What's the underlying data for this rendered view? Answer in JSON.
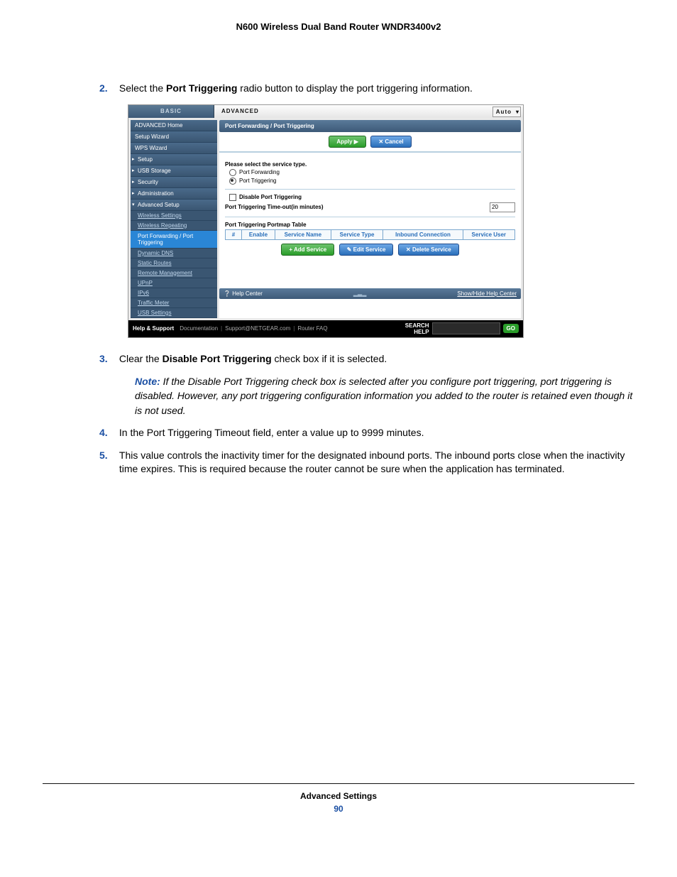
{
  "doc_title": "N600 Wireless Dual Band Router WNDR3400v2",
  "steps": {
    "s2": {
      "num": "2.",
      "pre": "Select the ",
      "bold": "Port Triggering",
      "post": " radio button to display the port triggering information."
    },
    "s3": {
      "num": "3.",
      "pre": "Clear the ",
      "bold": "Disable Port Triggering",
      "post": " check box if it is selected."
    },
    "s4": {
      "num": "4.",
      "text": "In the Port Triggering Timeout field, enter a value up to 9999 minutes."
    },
    "s5": {
      "num": "5.",
      "text": "This value controls the inactivity timer for the designated inbound ports. The inbound ports close when the inactivity time expires. This is required because the router cannot be sure when the application has terminated."
    }
  },
  "note": {
    "label": "Note:",
    "text": " If the Disable Port Triggering check box is selected after you configure port triggering, port triggering is disabled. However, any port triggering configuration information you added to the router is retained even though it is not used."
  },
  "shot": {
    "tabs": {
      "basic": "BASIC",
      "advanced": "ADVANCED",
      "auto": "Auto"
    },
    "sidebar": {
      "home": "ADVANCED Home",
      "setup_wiz": "Setup Wizard",
      "wps_wiz": "WPS Wizard",
      "setup": "Setup",
      "usb": "USB Storage",
      "security": "Security",
      "admin": "Administration",
      "adv_setup": "Advanced Setup",
      "subs": {
        "wireless": "Wireless Settings",
        "repeating": "Wireless Repeating",
        "port": "Port Forwarding / Port Triggering",
        "ddns": "Dynamic DNS",
        "routes": "Static Routes",
        "remote": "Remote Management",
        "upnp": "UPnP",
        "ipv6": "IPv6",
        "traffic": "Traffic Meter",
        "usbset": "USB Settings"
      }
    },
    "content": {
      "title": "Port Forwarding / Port Triggering",
      "apply": "Apply ▶",
      "cancel": "Cancel",
      "select_label": "Please select the service type.",
      "radio_fwd": "Port Forwarding",
      "radio_trig": "Port Triggering",
      "disable_trig": "Disable Port Triggering",
      "timeout_label": "Port Triggering Time-out(in minutes)",
      "timeout_value": "20",
      "portmap_title": "Port Triggering Portmap Table",
      "th": {
        "num": "#",
        "enable": "Enable",
        "name": "Service Name",
        "type": "Service Type",
        "inbound": "Inbound Connection",
        "user": "Service User"
      },
      "add": "Add Service",
      "edit": "Edit Service",
      "delete": "Delete Service",
      "help_center": "Help Center",
      "show_hide": "Show/Hide Help Center"
    },
    "support": {
      "label": "Help & Support",
      "doc": "Documentation",
      "email": "Support@NETGEAR.com",
      "faq": "Router FAQ",
      "search": "SEARCH",
      "help": "HELP",
      "go": "GO"
    }
  },
  "footer": {
    "title": "Advanced Settings",
    "page": "90"
  }
}
